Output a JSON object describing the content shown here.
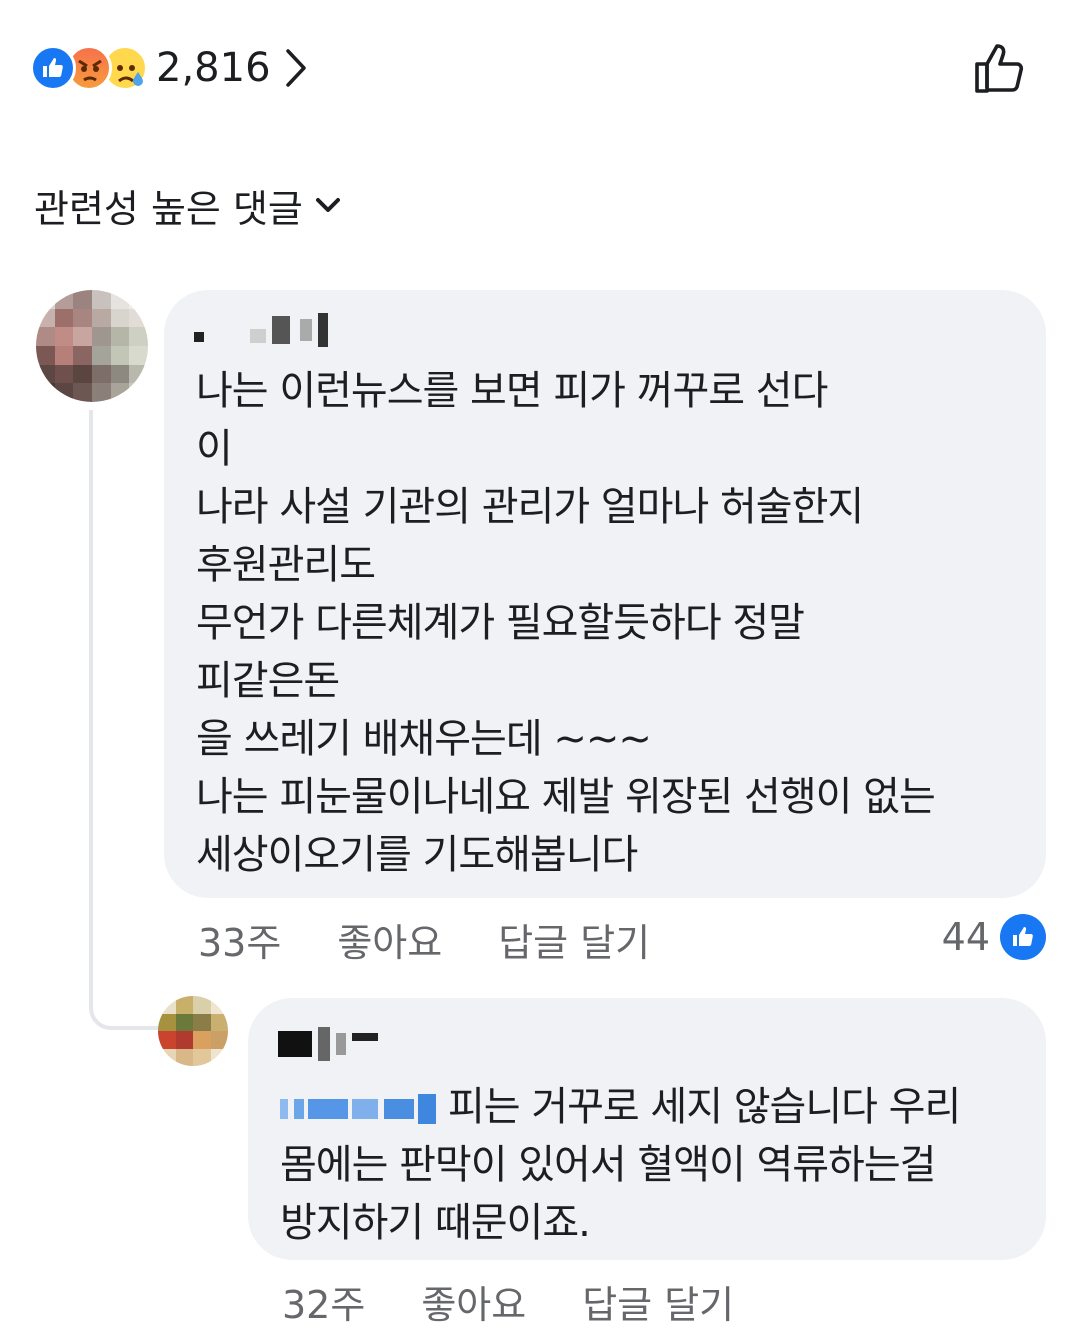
{
  "reactions": {
    "types": [
      "like",
      "angry",
      "sad"
    ],
    "count": "2,816"
  },
  "sort": {
    "label": "관련성 높은 댓글"
  },
  "comments": [
    {
      "author": "",
      "text": "나는 이런뉴스를 보면 피가 꺼꾸로 선다\n이\n나라 사설 기관의 관리가 얼마나 허술한지\n후원관리도\n무언가 다른체계가 필요할듯하다  정말\n피같은돈\n을  쓰레기 배채우는데 ~~~\n나는 피눈물이나네요 제발 위장된 선행이 없는\n세상이오기를 기도해봅니다",
      "time": "33주",
      "like_label": "좋아요",
      "reply_label": "답글 달기",
      "like_count": "44"
    },
    {
      "author": "",
      "mention": "",
      "text": "피는 거꾸로 세지 않습니다 우리\n몸에는 판막이 있어서 혈액이 역류하는걸\n방지하기 때문이죠.",
      "time": "32주",
      "like_label": "좋아요",
      "reply_label": "답글 달기"
    }
  ],
  "colors": {
    "accent": "#1877f2",
    "bubble": "#f0f2f5",
    "meta_text": "#65676b"
  }
}
